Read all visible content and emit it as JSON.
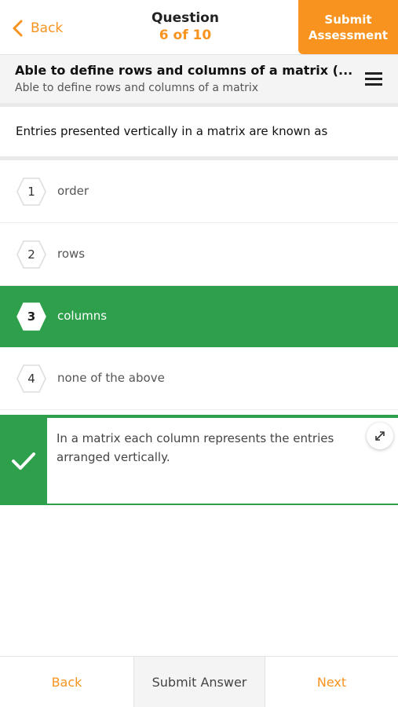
{
  "header": {
    "back_label": "Back",
    "question_label": "Question",
    "question_count": "6 of 10",
    "submit_assessment_line1": "Submit",
    "submit_assessment_line2": "Assessment"
  },
  "topic": {
    "title": "Able to define rows and columns of a matrix (...",
    "subtitle": "Able to define rows and columns of a matrix"
  },
  "question": {
    "text": "Entries presented vertically in a matrix are known as"
  },
  "options": [
    {
      "number": "1",
      "text": "order",
      "selected": false
    },
    {
      "number": "2",
      "text": "rows",
      "selected": false
    },
    {
      "number": "3",
      "text": "columns",
      "selected": true
    },
    {
      "number": "4",
      "text": "none of the above",
      "selected": false
    }
  ],
  "explanation": {
    "status": "correct",
    "text": "In a matrix each column represents the entries arranged vertically."
  },
  "footer": {
    "back_label": "Back",
    "submit_label": "Submit Answer",
    "next_label": "Next"
  },
  "icons": {
    "back": "chevron-left-icon",
    "menu": "hamburger-menu-icon",
    "check": "checkmark-icon",
    "expand": "expand-arrows-icon"
  },
  "colors": {
    "accent": "#f7931e",
    "correct": "#2ea04b"
  }
}
